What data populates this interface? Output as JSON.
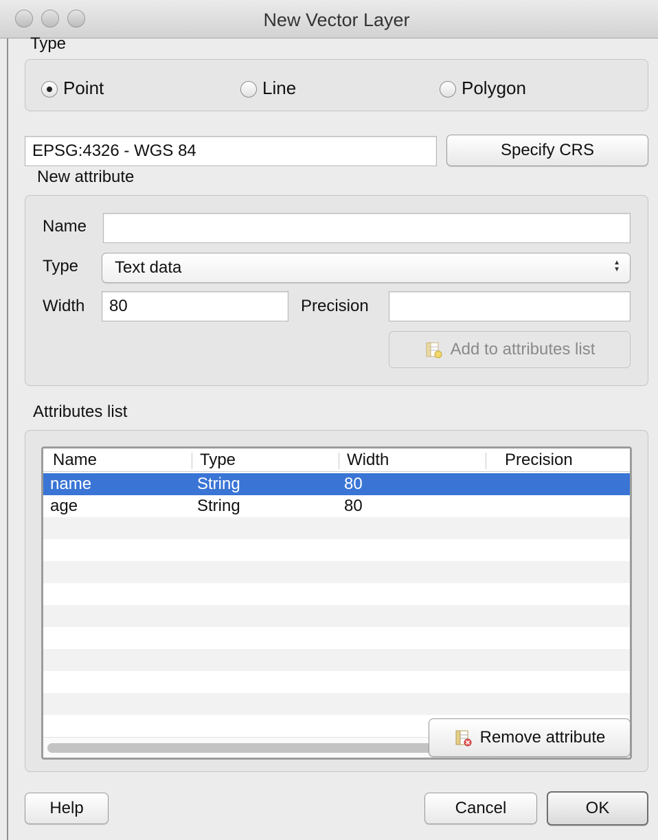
{
  "window": {
    "title": "New Vector Layer"
  },
  "type_group": {
    "label": "Type",
    "options": [
      {
        "label": "Point",
        "selected": true
      },
      {
        "label": "Line",
        "selected": false
      },
      {
        "label": "Polygon",
        "selected": false
      }
    ]
  },
  "crs": {
    "value": "EPSG:4326 - WGS 84",
    "button_label": "Specify CRS"
  },
  "new_attribute": {
    "label": "New attribute",
    "name_label": "Name",
    "name_value": "",
    "type_label": "Type",
    "type_value": "Text data",
    "width_label": "Width",
    "width_value": "80",
    "precision_label": "Precision",
    "precision_value": "",
    "add_button_label": "Add to attributes list"
  },
  "attributes_list": {
    "label": "Attributes list",
    "columns": [
      "Name",
      "Type",
      "Width",
      "Precision"
    ],
    "rows": [
      {
        "name": "name",
        "type": "String",
        "width": "80",
        "precision": "",
        "selected": true
      },
      {
        "name": "age",
        "type": "String",
        "width": "80",
        "precision": "",
        "selected": false
      }
    ],
    "remove_button_label": "Remove attribute"
  },
  "footer": {
    "help_label": "Help",
    "cancel_label": "Cancel",
    "ok_label": "OK"
  },
  "colors": {
    "selection": "#3a75d6",
    "window_bg": "#ececec"
  }
}
